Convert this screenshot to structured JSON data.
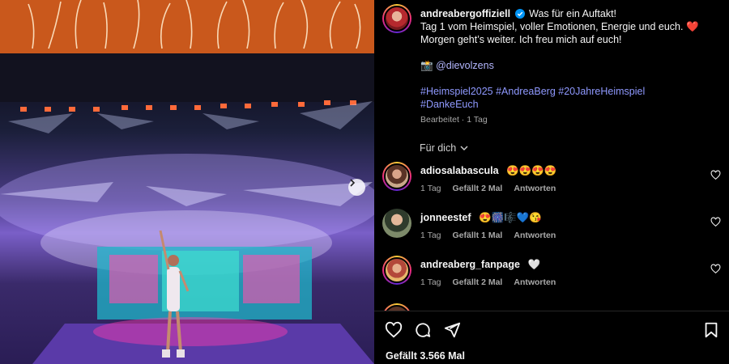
{
  "post": {
    "username": "andreabergoffiziell",
    "caption_lines": [
      "Was für ein Auftakt!",
      "Tag 1 vom Heimspiel, voller Emotionen, Energie und euch. ❤️",
      "Morgen geht’s weiter. Ich freu mich auf euch!"
    ],
    "camera_emoji": "📸",
    "mention": "@dievolzens",
    "hashtags_line1": "#Heimspiel2025 #AndreaBerg #20JahreHeimspiel",
    "hashtags_line2": "#DankeEuch",
    "edited": "Bearbeitet · 1 Tag",
    "for_you": "Für dich",
    "likes": "Gefällt 3.566 Mal"
  },
  "comments": [
    {
      "username": "adiosalabascula",
      "text": "😍😍😍😍",
      "time": "1 Tag",
      "likes": "Gefällt 2 Mal",
      "reply": "Antworten"
    },
    {
      "username": "jonneestef",
      "text": "😍🎆🎼💙😘",
      "time": "1 Tag",
      "likes": "Gefällt 1 Mal",
      "reply": "Antworten"
    },
    {
      "username": "andreaberg_fanpage",
      "text": "🤍",
      "time": "1 Tag",
      "likes": "Gefällt 2 Mal",
      "reply": "Antworten"
    }
  ],
  "colors": {
    "background": "#000000",
    "text": "#f5f5f5",
    "muted": "#a8a8a8",
    "hashtag": "#8f99ff",
    "verified": "#0095f6"
  },
  "icons": [
    "verified-badge-icon",
    "chevron-down-icon",
    "heart-icon",
    "comment-icon",
    "share-icon",
    "bookmark-icon",
    "chevron-right-icon"
  ]
}
